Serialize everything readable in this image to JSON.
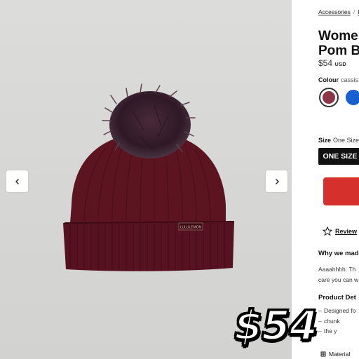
{
  "gallery": {
    "prev_icon": "chevron-left-icon",
    "next_icon": "chevron-right-icon",
    "product_label": "LULULEMON",
    "colors": {
      "background": "#d8d8d6",
      "beanie": "#5c1420",
      "pom": "#3a1f2c"
    }
  },
  "product": {
    "breadcrumb": [
      "Accessories",
      "K"
    ],
    "title_line1": "Women",
    "title_line2": "Pom B",
    "price": "$54",
    "currency": "USD",
    "colour_label": "Colour",
    "colour_value": "cassis",
    "swatches": [
      {
        "name": "cassis",
        "color": "#8e3647",
        "selected": true
      },
      {
        "name": "blue",
        "color": "#1a5fcf",
        "selected": false
      }
    ],
    "size_label": "Size",
    "size_value": "One Size",
    "size_option": "ONE SIZE",
    "add_to_bag_color": "#d5302c",
    "reviews_label": "Review",
    "why_heading": "Why we mad",
    "why_body_line1": "Aaaahhhh. Th",
    "why_body_line2": "care you can w",
    "details_heading": "Product Det",
    "details_items": [
      "Designed fo",
      "chunk",
      "the y"
    ],
    "material_label": "Material"
  },
  "overlay": {
    "price": "$54"
  }
}
